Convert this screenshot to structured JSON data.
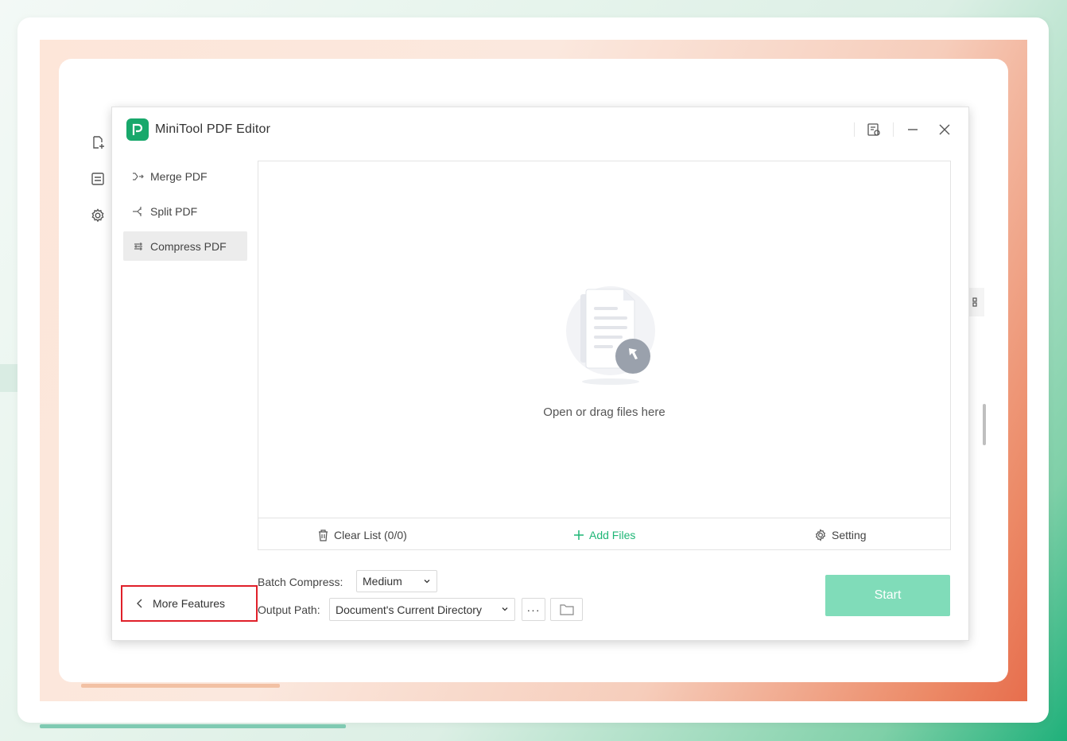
{
  "app": {
    "title": "MiniTool PDF Editor"
  },
  "nav": {
    "items": [
      {
        "label": "Merge PDF",
        "icon": "merge-icon",
        "active": false
      },
      {
        "label": "Split PDF",
        "icon": "split-icon",
        "active": false
      },
      {
        "label": "Compress PDF",
        "icon": "compress-icon",
        "active": true
      }
    ]
  },
  "drop_zone": {
    "text": "Open or drag files here"
  },
  "toolbar": {
    "clear_label": "Clear List (0/0)",
    "add_label": "Add Files",
    "setting_label": "Setting"
  },
  "options": {
    "batch_label": "Batch Compress:",
    "batch_value": "Medium",
    "output_label": "Output Path:",
    "output_value": "Document's Current Directory",
    "more_label": "···"
  },
  "start_label": "Start",
  "more_features_label": "More Features",
  "colors": {
    "accent": "#1fb676",
    "start_disabled": "#80dcb9",
    "highlight_border": "#e0202a"
  }
}
